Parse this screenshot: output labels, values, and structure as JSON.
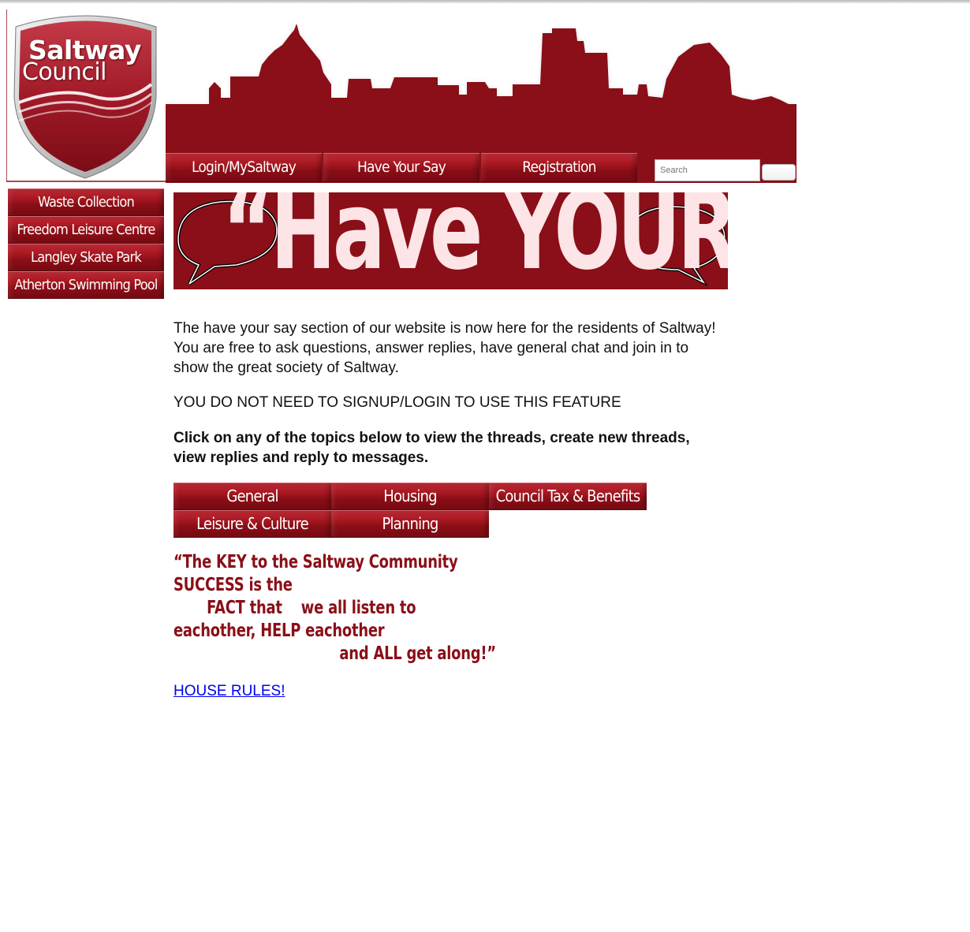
{
  "logo": {
    "line1": "Saltway",
    "line2": "Council"
  },
  "topnav": [
    {
      "label": "Login/MySaltway"
    },
    {
      "label": "Have Your Say"
    },
    {
      "label": "Registration"
    }
  ],
  "search": {
    "placeholder": "Search",
    "button_label": ""
  },
  "sidenav": [
    {
      "label": "Waste Collection"
    },
    {
      "label": "Freedom Leisure Centre"
    },
    {
      "label": "Langley Skate Park"
    },
    {
      "label": "Atherton Swimming Pool"
    }
  ],
  "banner": {
    "text": "“Have YOUR say”"
  },
  "content": {
    "intro": "The have your say section of our website is now here for the residents of Saltway! You are free to ask questions, answer replies, have general chat and join in to show the great society of Saltway.",
    "notice": "YOU DO NOT NEED TO SIGNUP/LOGIN TO USE THIS FEATURE",
    "instructions": "Click on any of the topics below to view the threads, create new threads, view replies and reply to messages."
  },
  "topics": [
    {
      "label": "General"
    },
    {
      "label": "Housing"
    },
    {
      "label": "Council Tax & Benefits"
    },
    {
      "label": "Leisure & Culture"
    },
    {
      "label": "Planning"
    }
  ],
  "quote": {
    "line1": "“The KEY to the Saltway Community",
    "line2": "SUCCESS is the",
    "line3": "       FACT that    we all listen to",
    "line4": "eachother, HELP eachother",
    "line5": "                                   and ALL get along!”"
  },
  "house_rules": {
    "label": "HOUSE RULES!"
  },
  "colors": {
    "brand": "#8a0f18",
    "banner_text": "#fde4e6",
    "link": "#0000ee"
  }
}
